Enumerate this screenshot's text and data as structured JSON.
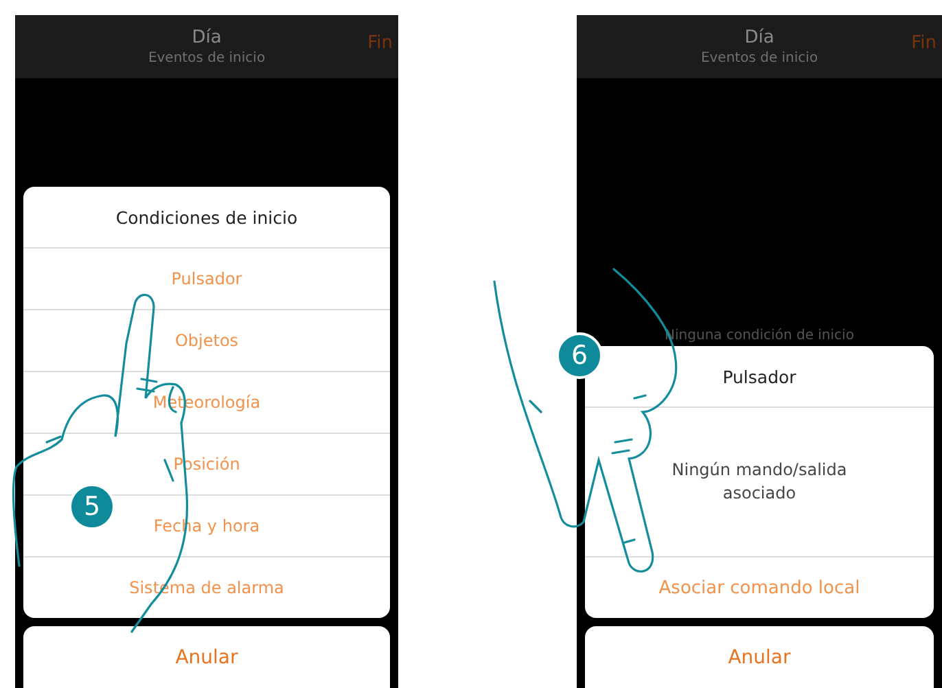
{
  "steps": [
    {
      "number": "5",
      "header": {
        "title": "Día",
        "subtitle": "Eventos de inicio",
        "action": "Fin"
      },
      "sheet": {
        "kind": "list",
        "title": "Condiciones de inicio",
        "items": [
          "Pulsador",
          "Objetos",
          "Meteorología",
          "Posición",
          "Fecha y hora",
          "Sistema de alarma"
        ]
      },
      "cancel": "Anular"
    },
    {
      "number": "6",
      "header": {
        "title": "Día",
        "subtitle": "Eventos de inicio",
        "action": "Fin"
      },
      "background_text": "Ninguna condición de inicio",
      "sheet": {
        "kind": "detail",
        "title": "Pulsador",
        "message": "Ningún mando/salida asociado",
        "action": "Asociar comando local"
      },
      "cancel": "Anular"
    }
  ]
}
